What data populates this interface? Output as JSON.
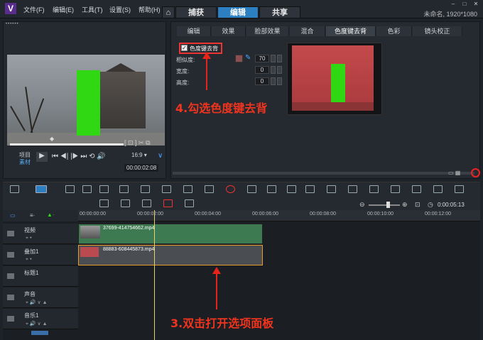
{
  "titlebar": {
    "menus": [
      "文件(F)",
      "编辑(E)",
      "工具(T)",
      "设置(S)",
      "帮助(H)"
    ],
    "tabs": [
      "捕获",
      "编辑",
      "共享"
    ],
    "home_icon": "home-icon",
    "project_info": "未命名, 1920*1080"
  },
  "preview": {
    "project_label": "项目",
    "clip_label": "素材",
    "timecode": "00:00:02:08"
  },
  "options": {
    "tabs": [
      "编辑",
      "效果",
      "脸部效果",
      "混合",
      "色度键去背",
      "色彩",
      "镜头校正"
    ],
    "active_tab": "色度键去背",
    "chroma_checkbox": "色度键去背",
    "similarity_label": "相似度:",
    "similarity_value": "70",
    "width_label": "宽度:",
    "width_value": "0",
    "height_label": "高度:",
    "height_value": "0",
    "key_color": "#8b4f4f"
  },
  "annotations": {
    "step4": "4.勾选色度键去背",
    "step3": "3.双击打开选项面板"
  },
  "timeline": {
    "ruler": [
      "00:00:00:00",
      "00:00:02:00",
      "00:00:04:00",
      "00:00:06:00",
      "00:00:08:00",
      "00:00:10:00",
      "00:00:12:00"
    ],
    "zoom_timecode": "0:00:05:13",
    "tracks": [
      {
        "name": "视频",
        "clip": "37699-414754662.mp4"
      },
      {
        "name": "叠加1",
        "clip": "88883-608445873.mp4"
      },
      {
        "name": "标题1",
        "clip": ""
      },
      {
        "name": "声音",
        "clip": ""
      },
      {
        "name": "音乐1",
        "clip": ""
      }
    ]
  },
  "colors": {
    "accent": "#2c7fc1",
    "annotation": "#f0341e",
    "green_screen": "#2fd813",
    "video_clip": "#3d7a52"
  }
}
